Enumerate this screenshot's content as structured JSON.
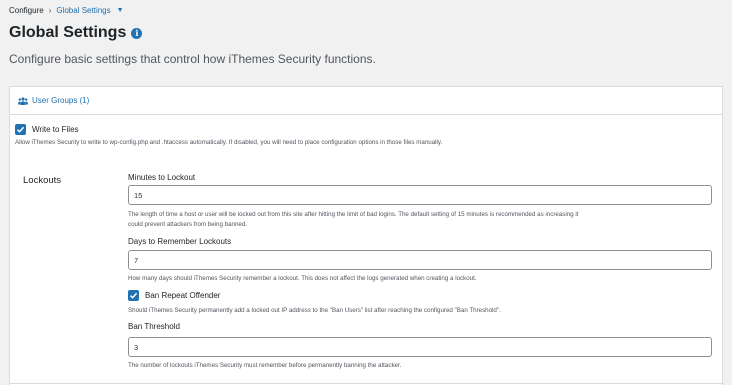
{
  "breadcrumb": {
    "root": "Configure",
    "separator": "›",
    "current": "Global Settings"
  },
  "page": {
    "title": "Global Settings",
    "subtitle": "Configure basic settings that control how iThemes Security functions."
  },
  "tabs": {
    "user_groups": "User Groups (1)"
  },
  "write_to_files": {
    "label": "Write to Files",
    "checked": true,
    "description": "Allow iThemes Security to write to wp-config.php and .htaccess automatically. If disabled, you will need to place configuration options in those files manually."
  },
  "lockouts": {
    "section_label": "Lockouts",
    "minutes": {
      "label": "Minutes to Lockout",
      "value": "15",
      "description_1": "The length of time a host or user will be locked out from this site after hitting the limit of bad logins. The default setting of 15 minutes is recommended as increasing it",
      "description_2": "could prevent attackers from being banned."
    },
    "days": {
      "label": "Days to Remember Lockouts",
      "value": "7",
      "description": "How many days should iThemes Security remember a lockout. This does not affect the logs generated when creating a lockout."
    },
    "ban_repeat": {
      "label": "Ban Repeat Offender",
      "checked": true,
      "description": "Should iThemes Security permanently add a locked out IP address to the \"Ban Users\" list after reaching the configured \"Ban Threshold\"."
    },
    "ban_threshold": {
      "label": "Ban Threshold",
      "value": "3",
      "description": "The number of lockouts iThemes Security must remember before permanently banning the attacker."
    }
  },
  "colors": {
    "accent": "#2271b1",
    "text": "#1d2327",
    "muted": "#50575e",
    "border": "#dcdcde"
  }
}
